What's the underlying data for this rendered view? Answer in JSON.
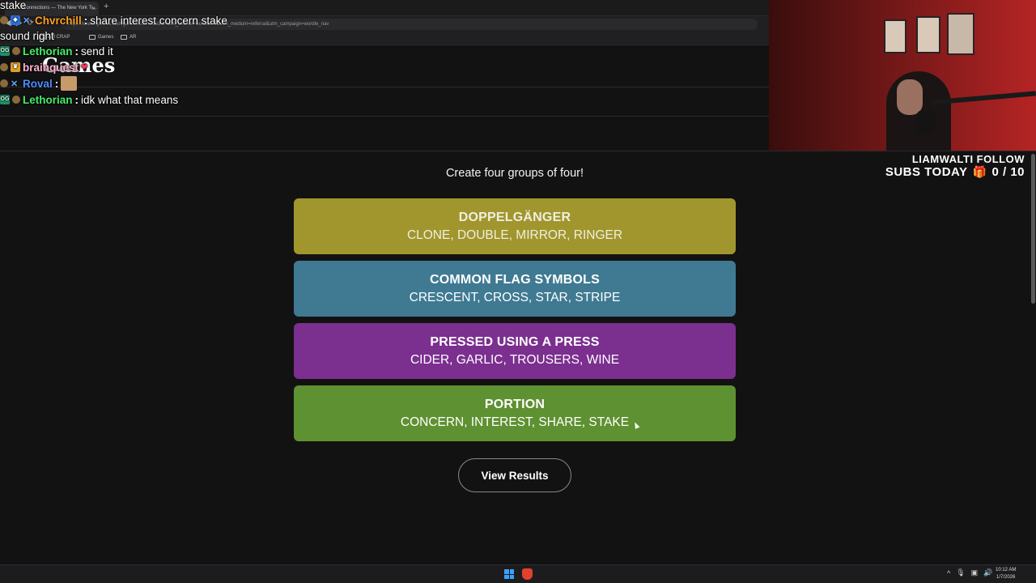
{
  "browser": {
    "tab_title": "Connections — The New York Ti...",
    "tab_close": "×",
    "new_tab": "+",
    "url": "https://www.nytimes.com/games/connections?utm_source=wordlebot&utm_medium=referral&utm_campaign=wordle_nav",
    "bookmarks": [
      "AM CRAP",
      "Games",
      "AR"
    ]
  },
  "site": {
    "logo": "Games"
  },
  "chat": {
    "lines": [
      {
        "user": "",
        "message": "stake"
      },
      {
        "user": "Chvrchill",
        "message": "share interest concern stake"
      },
      {
        "user": "",
        "message": "sound right"
      },
      {
        "user": "Lethorian",
        "message": "send it"
      },
      {
        "user": "brainquest",
        "message": ""
      },
      {
        "user": "Roval",
        "message": ""
      },
      {
        "user": "Lethorian",
        "message": "idk what that means"
      }
    ]
  },
  "overlay": {
    "follow": "LIAMWALTI FOLLOW",
    "subs_label": "SUBS TODAY",
    "subs_count": "0 / 10",
    "gift_icon": "gift-icon"
  },
  "game": {
    "instructions": "Create four groups of four!",
    "groups": [
      {
        "title": "DOPPELGÄNGER",
        "words": "CLONE, DOUBLE, MIRROR, RINGER",
        "color": "#a1962e"
      },
      {
        "title": "COMMON FLAG SYMBOLS",
        "words": "CRESCENT, CROSS, STAR, STRIPE",
        "color": "#3f7a92"
      },
      {
        "title": "PRESSED USING A PRESS",
        "words": "CIDER, GARLIC, TROUSERS, WINE",
        "color": "#7b2f8f"
      },
      {
        "title": "PORTION",
        "words": "CONCERN, INTEREST, SHARE, STAKE",
        "color": "#5e9131"
      }
    ],
    "view_results": "View Results"
  },
  "taskbar": {
    "time": "10:12 AM",
    "date": "1/7/2026"
  }
}
